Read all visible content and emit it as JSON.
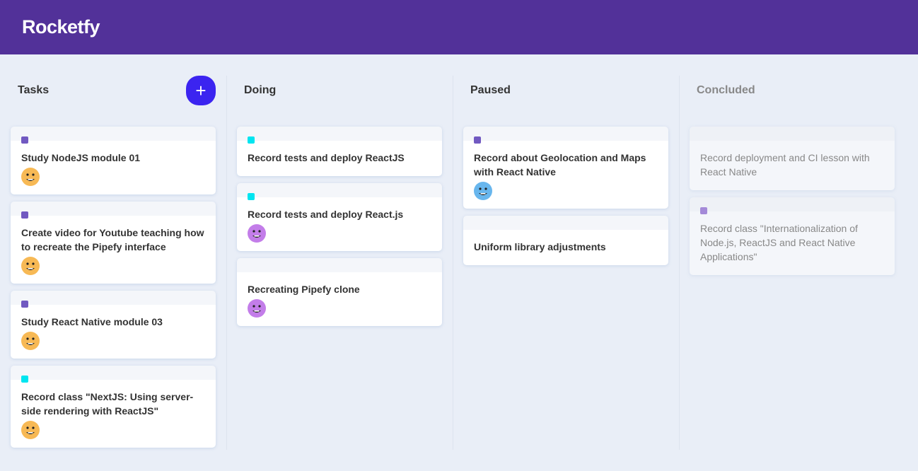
{
  "app": {
    "title": "Rocketfy"
  },
  "colors": {
    "header": "#523199",
    "background": "#e9eef7",
    "add_button": "#3b24f0",
    "label_purple": "#7159c1",
    "label_cyan": "#00e5f0",
    "label_lilac": "#a48ad8",
    "avatar_orange": "#f7b955",
    "avatar_purple": "#c37de9",
    "avatar_blue": "#68b6ed"
  },
  "lists": [
    {
      "title": "Tasks",
      "add_button": "+",
      "cards": [
        {
          "content": "Study NodeJS module 01",
          "label": "purple",
          "avatar": "orange"
        },
        {
          "content": "Create video for Youtube teaching how to recreate the Pipefy interface",
          "label": "purple",
          "avatar": "orange"
        },
        {
          "content": "Study React Native module 03",
          "label": "purple",
          "avatar": "orange"
        },
        {
          "content": "Record class \"NextJS: Using server-side rendering with ReactJS\"",
          "label": "cyan",
          "avatar": "orange"
        }
      ]
    },
    {
      "title": "Doing",
      "cards": [
        {
          "content": "Record tests and deploy ReactJS",
          "label": "cyan"
        },
        {
          "content": "Record tests and deploy React.js",
          "label": "cyan",
          "avatar": "purple"
        },
        {
          "content": "Recreating Pipefy clone",
          "avatar": "purple"
        }
      ]
    },
    {
      "title": "Paused",
      "cards": [
        {
          "content": "Record about Geolocation and Maps with React Native",
          "label": "purple",
          "avatar": "blue"
        },
        {
          "content": "Uniform library adjustments"
        }
      ]
    },
    {
      "title": "Concluded",
      "cards": [
        {
          "content": "Record deployment and CI lesson with React Native"
        },
        {
          "content": "Record class \"Internationalization of Node.js, ReactJS and React Native Applications\"",
          "label": "lilac"
        }
      ]
    }
  ]
}
